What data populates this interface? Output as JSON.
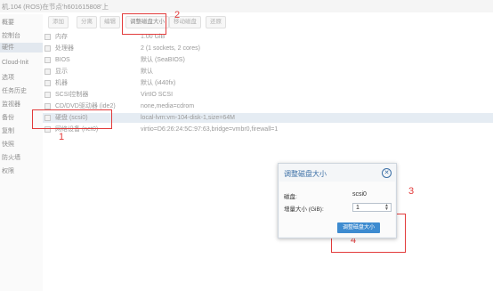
{
  "header": {
    "vm_title": "机.104 (ROS)在节点'h601615808'上"
  },
  "sidebar": {
    "items": [
      {
        "label": "概要"
      },
      {
        "label": "控制台"
      },
      {
        "label": "硬件"
      },
      {
        "label": "Cloud-Init"
      },
      {
        "label": "选项"
      },
      {
        "label": "任务历史"
      },
      {
        "label": "监视器"
      },
      {
        "label": "备份"
      },
      {
        "label": "复制"
      },
      {
        "label": "快照"
      },
      {
        "label": "防火墙"
      },
      {
        "label": "权限"
      }
    ],
    "active_index": 2
  },
  "toolbar": {
    "add_label": "添加",
    "remove_label": "分离",
    "edit_label": "编辑",
    "resize_label": "调整磁盘大小",
    "move_label": "移动磁盘",
    "revert_label": "还原"
  },
  "hardware": {
    "rows": [
      {
        "label": "内存",
        "value": "1.00 GiB"
      },
      {
        "label": "处理器",
        "value": "2 (1 sockets, 2 cores)"
      },
      {
        "label": "BIOS",
        "value": "默认 (SeaBIOS)"
      },
      {
        "label": "显示",
        "value": "默认"
      },
      {
        "label": "机器",
        "value": "默认 (i440fx)"
      },
      {
        "label": "SCSI控制器",
        "value": "VirtIO SCSI"
      },
      {
        "label": "CD/DVD驱动器 (ide2)",
        "value": "none,media=cdrom"
      },
      {
        "label": "硬盘 (scsi0)",
        "value": "local-lvm:vm-104-disk-1,size=64M"
      },
      {
        "label": "网络设备 (net0)",
        "value": "virtio=D6:26:24:5C:97:63,bridge=vmbr0,firewall=1"
      }
    ],
    "selected_index": 7
  },
  "dialog": {
    "title": "调整磁盘大小",
    "disk_label": "磁盘:",
    "disk_value": "scsi0",
    "size_label": "增量大小 (GiB):",
    "size_value": "1",
    "submit_label": "调整磁盘大小"
  },
  "annotations": {
    "n1": "1",
    "n2": "2",
    "n3": "3",
    "n4": "4"
  }
}
